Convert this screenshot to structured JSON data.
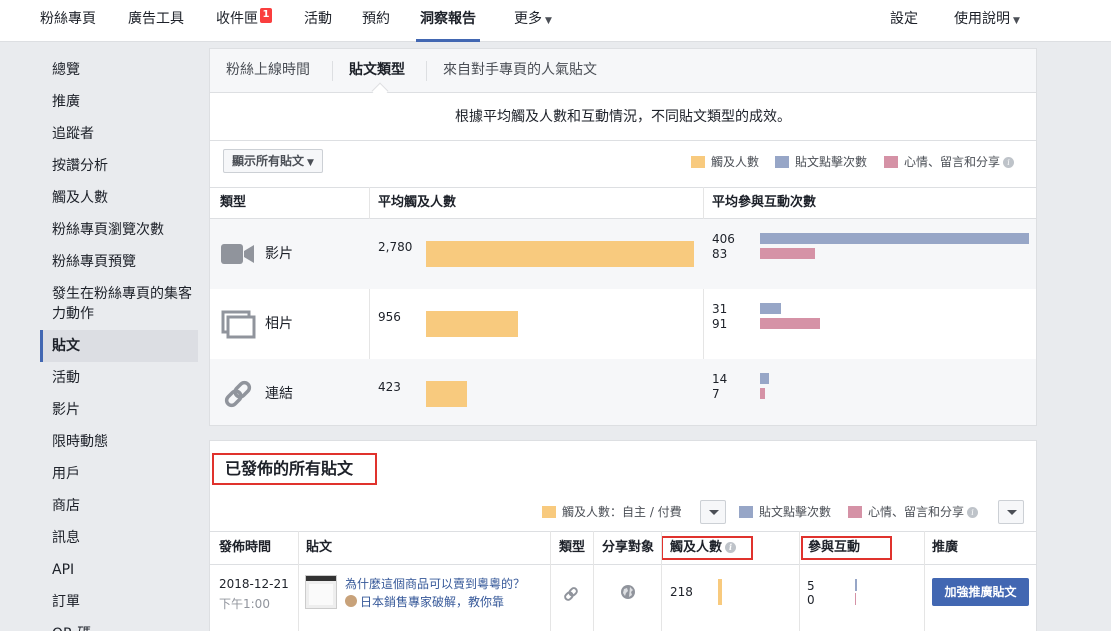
{
  "nav": {
    "items": [
      "粉絲專頁",
      "廣告工具",
      "收件匣",
      "活動",
      "預約",
      "洞察報告",
      "更多"
    ],
    "inbox_badge": "1",
    "settings": "設定",
    "help": "使用說明"
  },
  "sidebar": {
    "items": [
      "總覽",
      "推廣",
      "追蹤者",
      "按讚分析",
      "觸及人數",
      "粉絲專頁瀏覽次數",
      "粉絲專頁預覽",
      "發生在粉絲專頁的集客力動作",
      "貼文",
      "活動",
      "影片",
      "限時動態",
      "用戶",
      "商店",
      "訊息",
      "API",
      "訂單",
      "QR 碼"
    ],
    "active_index": 8
  },
  "tabs": [
    "粉絲上線時間",
    "貼文類型",
    "來自對手專頁的人氣貼文"
  ],
  "description": "根據平均觸及人數和互動情況，不同貼文類型的成效。",
  "filter_label": "顯示所有貼文",
  "legend": {
    "reach": "觸及人數",
    "clicks": "貼文點擊次數",
    "reactions": "心情、留言和分享"
  },
  "colors": {
    "reach": "#f8ca7e",
    "clicks": "#97a6c7",
    "reactions": "#d592a6",
    "accent": "#4267b2",
    "highlight": "#e0322d"
  },
  "table": {
    "headers": [
      "類型",
      "平均觸及人數",
      "平均參與互動次數"
    ],
    "rows": [
      {
        "icon": "video-icon",
        "type": "影片",
        "reach": 2780,
        "reach_label": "2,780",
        "clicks": 406,
        "reactions": 83
      },
      {
        "icon": "photo-icon",
        "type": "相片",
        "reach": 956,
        "reach_label": "956",
        "clicks": 31,
        "reactions": 91
      },
      {
        "icon": "link-icon",
        "type": "連結",
        "reach": 423,
        "reach_label": "423",
        "clicks": 14,
        "reactions": 7
      }
    ],
    "reach_max": 2780,
    "engagement_max": 406
  },
  "published": {
    "title": "已發佈的所有貼文",
    "legend_reach": "觸及人數：自主 / 付費",
    "legend_clicks": "貼文點擊次數",
    "legend_reactions": "心情、留言和分享",
    "headers": [
      "發佈時間",
      "貼文",
      "類型",
      "分享對象",
      "觸及人數",
      "參與互動",
      "推廣"
    ],
    "row": {
      "date": "2018-12-21",
      "time": "下午1:00",
      "title_line1": "為什麼這個商品可以賣到粵粵的？",
      "title_line2": "日本銷售專家破解，教你靠",
      "reach": "218",
      "clicks": "5",
      "reactions": "0",
      "boost": "加強推廣貼文"
    }
  }
}
